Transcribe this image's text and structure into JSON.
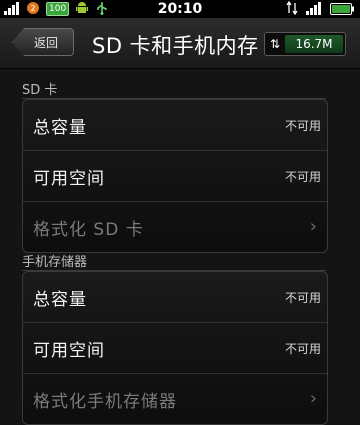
{
  "status_bar": {
    "time": "20:10",
    "icons": [
      "signal-bars-icon",
      "notification-badge-icon",
      "battery-100-icon",
      "android-debug-icon",
      "usb-icon",
      "data-transfer-icon",
      "wifi-bars-icon",
      "battery-full-icon"
    ],
    "badge_text": "100"
  },
  "title_bar": {
    "back_label": "返回",
    "title": "SD 卡和手机内存",
    "traffic_arrows": "⇅",
    "traffic_value": "16.7M"
  },
  "sections": [
    {
      "header": "SD 卡",
      "rows": [
        {
          "label": "总容量",
          "value": "不可用"
        },
        {
          "label": "可用空间",
          "value": "不可用"
        },
        {
          "label": "格式化 SD 卡",
          "chevron": "›"
        }
      ]
    },
    {
      "header": "手机存储器",
      "rows": [
        {
          "label": "总容量",
          "value": "不可用"
        },
        {
          "label": "可用空间",
          "value": "不可用"
        },
        {
          "label": "格式化手机存储器",
          "chevron": "›"
        }
      ]
    }
  ],
  "colors": {
    "background": "#141414",
    "accent_green": "#2f8a3e"
  }
}
